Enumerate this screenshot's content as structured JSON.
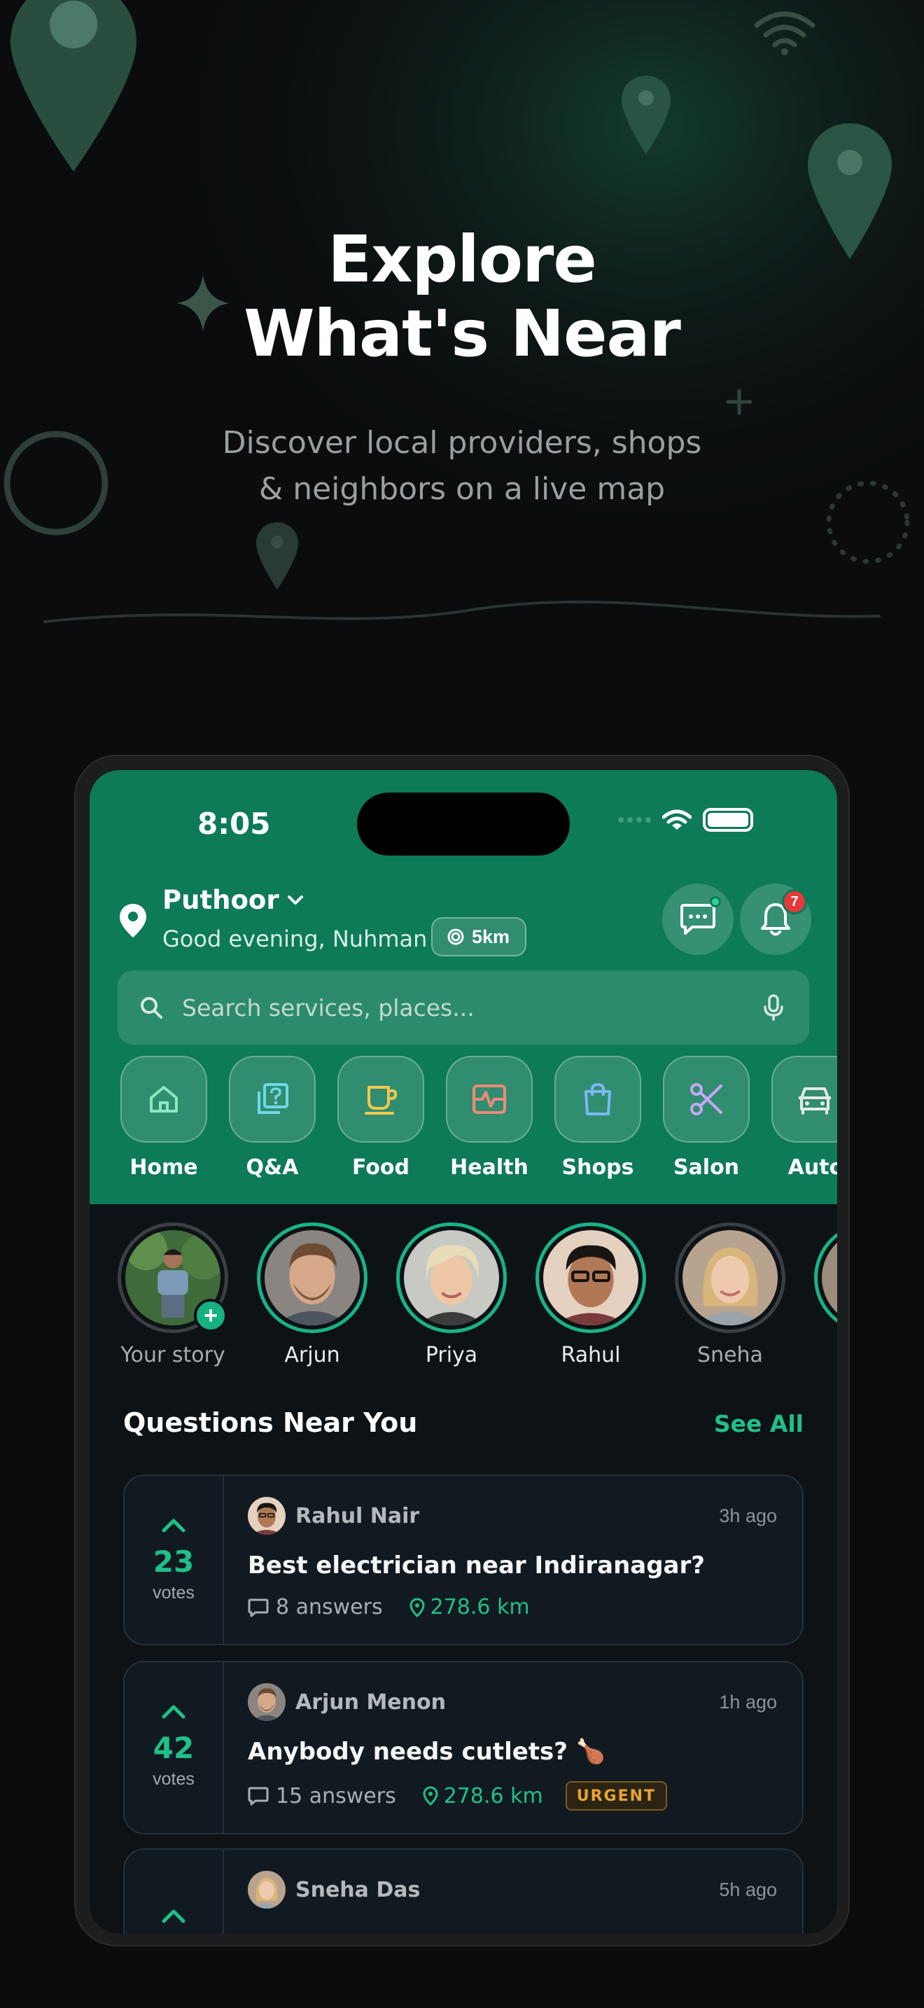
{
  "hero": {
    "title_line1": "Explore",
    "title_line2": "What's Near",
    "subtitle_line1": "Discover local providers, shops",
    "subtitle_line2": "& neighbors on a live map"
  },
  "status_bar": {
    "time": "8:05"
  },
  "location": {
    "name": "Puthoor",
    "greeting": "Good evening, Nuhman",
    "radius": "5km"
  },
  "header": {
    "notifications_count": "7"
  },
  "search": {
    "placeholder": "Search services, places..."
  },
  "categories": [
    {
      "label": "Home",
      "icon": "home-icon",
      "color": "#8ee7c3"
    },
    {
      "label": "Q&A",
      "icon": "question-icon",
      "color": "#6fd9e8"
    },
    {
      "label": "Food",
      "icon": "cup-icon",
      "color": "#f2c94c"
    },
    {
      "label": "Health",
      "icon": "health-icon",
      "color": "#f08a7a"
    },
    {
      "label": "Shops",
      "icon": "bag-icon",
      "color": "#7cb8f5"
    },
    {
      "label": "Salon",
      "icon": "scissors-icon",
      "color": "#c6a8f5"
    },
    {
      "label": "Autc",
      "icon": "car-icon",
      "color": "#e6e9eb"
    }
  ],
  "stories": [
    {
      "name": "Your story"
    },
    {
      "name": "Arjun"
    },
    {
      "name": "Priya"
    },
    {
      "name": "Rahul"
    },
    {
      "name": "Sneha"
    }
  ],
  "questions_section": {
    "title": "Questions Near You",
    "see_all": "See All"
  },
  "questions": [
    {
      "author": "Rahul Nair",
      "time": "3h ago",
      "votes": "23",
      "votes_label": "votes",
      "text": "Best electrician near Indiranagar?",
      "answers": "8 answers",
      "distance": "278.6 km"
    },
    {
      "author": "Arjun Menon",
      "time": "1h ago",
      "votes": "42",
      "votes_label": "votes",
      "text": "Anybody needs cutlets? 🍗",
      "answers": "15 answers",
      "distance": "278.6 km",
      "tag": "URGENT"
    },
    {
      "author": "Sneha Das",
      "time": "5h ago"
    }
  ],
  "colors": {
    "accent": "#1fc08a",
    "header_green": "#0d7a58",
    "urgent": "#e9a532",
    "badge_red": "#e5393a"
  }
}
